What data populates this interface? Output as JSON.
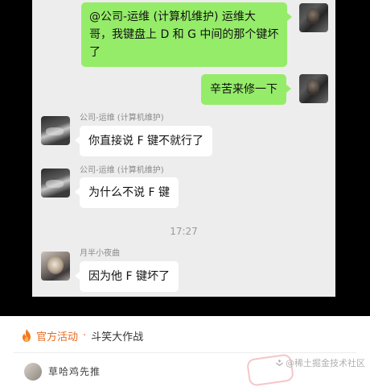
{
  "chat": {
    "messages": [
      {
        "side": "right",
        "text": "@公司-运维 (计算机维护) 运维大哥，我键盘上 D 和 G 中间的那个键坏了"
      },
      {
        "side": "right",
        "text": "辛苦来修一下"
      },
      {
        "side": "left",
        "sender": "公司-运维 (计算机维护)",
        "text": "你直接说 F 键不就行了"
      },
      {
        "side": "left",
        "sender": "公司-运维 (计算机维护)",
        "text": "为什么不说 F 键"
      },
      {
        "side": "left",
        "sender": "月半小夜曲",
        "text": "因为他 F 键坏了"
      }
    ],
    "msg1_line1": "@公司-运维 (计算机维护) 运维大",
    "msg1_line2": "哥，我键盘上 D 和 G 中间的那个键坏",
    "msg1_line3": "了",
    "msg2": "辛苦来修一下",
    "sender_ops": "公司-运维 (计算机维护)",
    "msg3": "你直接说 F 键不就行了",
    "msg4": "为什么不说 F 键",
    "timestamp": "17:27",
    "sender_moon": "月半小夜曲",
    "msg5": "因为他 F 键坏了"
  },
  "activity": {
    "icon": "fire-icon",
    "label": "官方活动",
    "separator": "·",
    "title": "斗笑大作战"
  },
  "bottom": {
    "username": "草哈鸡先推"
  },
  "watermark": {
    "text": "@稀土掘金技术社区"
  },
  "colors": {
    "my_bubble": "#95ec69",
    "their_bubble": "#ffffff",
    "chat_bg": "#ededed",
    "activity_accent": "#e96a1e"
  }
}
